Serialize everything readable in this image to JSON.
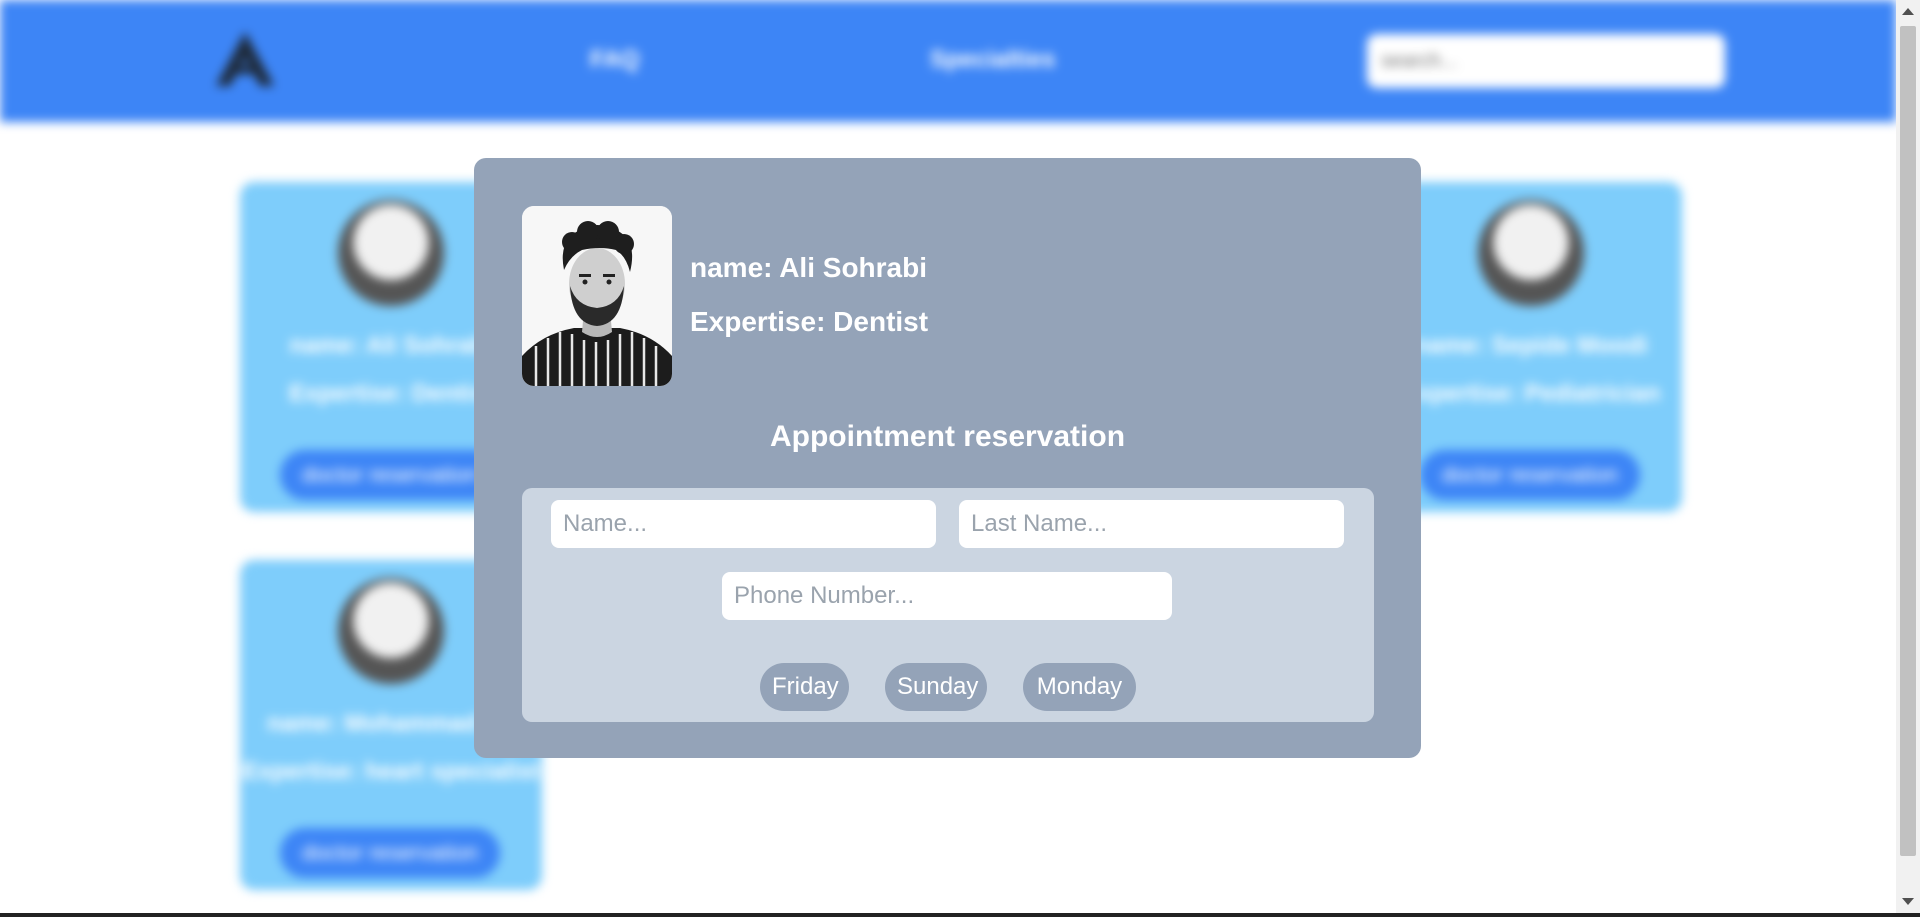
{
  "navbar": {
    "links": [
      "FAQ",
      "Specialties"
    ],
    "search_placeholder": "search..."
  },
  "cards": [
    {
      "name": "name: Ali Sohrabi",
      "expertise": "Expertise: Dentist",
      "button": "doctor reservation"
    },
    {
      "name": "name: Sepide Moodi",
      "expertise": "Expertise: Pediatrician",
      "button": "doctor reservation"
    },
    {
      "name": "name: Mohammad Re",
      "expertise": "Expertise: heart specialist",
      "button": "doctor reservation"
    }
  ],
  "modal": {
    "doctor_name": "name: Ali Sohrabi",
    "doctor_expertise": "Expertise: Dentist",
    "title": "Appointment reservation",
    "form": {
      "name_placeholder": "Name...",
      "lastname_placeholder": "Last Name...",
      "phone_placeholder": "Phone Number..."
    },
    "days": [
      "Friday",
      "Sunday",
      "Monday"
    ]
  },
  "colors": {
    "navbar": "#3d85f6",
    "card": "#7ecdfb",
    "modal": "#94a3b8",
    "form_box": "#cbd5e1"
  }
}
